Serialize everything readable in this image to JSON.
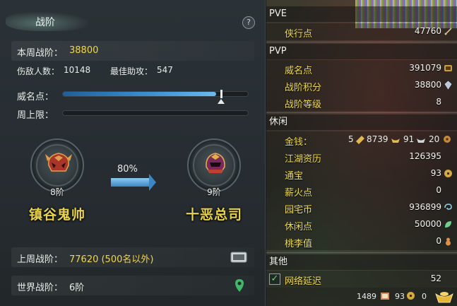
{
  "left": {
    "title": "战阶",
    "help_label": "?",
    "weekly_rank_label": "本周战阶：",
    "weekly_rank_value": "38800",
    "kills_label": "伤敌人数：",
    "kills_value": "10148",
    "assists_label": "最佳助攻：",
    "assists_value": "547",
    "prestige_label": "威名点：",
    "prestige_progress": 0.83,
    "weekly_cap_label": "周上限：",
    "weekly_cap_progress": 0,
    "current_rank": {
      "level": "8阶",
      "name": "镇谷鬼帅"
    },
    "progress_percent": "80%",
    "next_rank": {
      "level": "9阶",
      "name": "十恶总司"
    },
    "last_week_label": "上周战阶：",
    "last_week_value": "77620 (500名以外)",
    "world_rank_label": "世界战阶：",
    "world_rank_value": "6阶"
  },
  "right": {
    "pve_title": "PVE",
    "pve": [
      {
        "label": "侠行点",
        "value": "47760",
        "icon": "sword-icon"
      }
    ],
    "pvp_title": "PVP",
    "pvp": [
      {
        "label": "威名点",
        "value": "391079",
        "icon": "prestige-icon"
      },
      {
        "label": "战阶积分",
        "value": "38800",
        "icon": "crystal-icon"
      },
      {
        "label": "战阶等级",
        "value": "8"
      }
    ],
    "leisure_title": "休闲",
    "money": {
      "label": "金钱：",
      "prefix": "5",
      "gold": "8739",
      "silver": "91",
      "copper": "20"
    },
    "leisure": [
      {
        "label": "江湖资历",
        "value": "126395"
      },
      {
        "label": "通宝",
        "value": "93",
        "icon": "coin-icon"
      },
      {
        "label": "薪火点",
        "value": "0"
      },
      {
        "label": "园宅币",
        "value": "936899",
        "icon": "swirl-icon"
      },
      {
        "label": "休闲点",
        "value": "50000",
        "icon": "leaf-icon"
      },
      {
        "label": "桃李值",
        "value": "0",
        "icon": "gourd-icon"
      }
    ],
    "other_title": "其他",
    "latency": {
      "label": "网络延迟",
      "value": "52",
      "checked": true
    },
    "bottom": {
      "value1": "1489",
      "value2": "93",
      "value3": "0"
    }
  }
}
